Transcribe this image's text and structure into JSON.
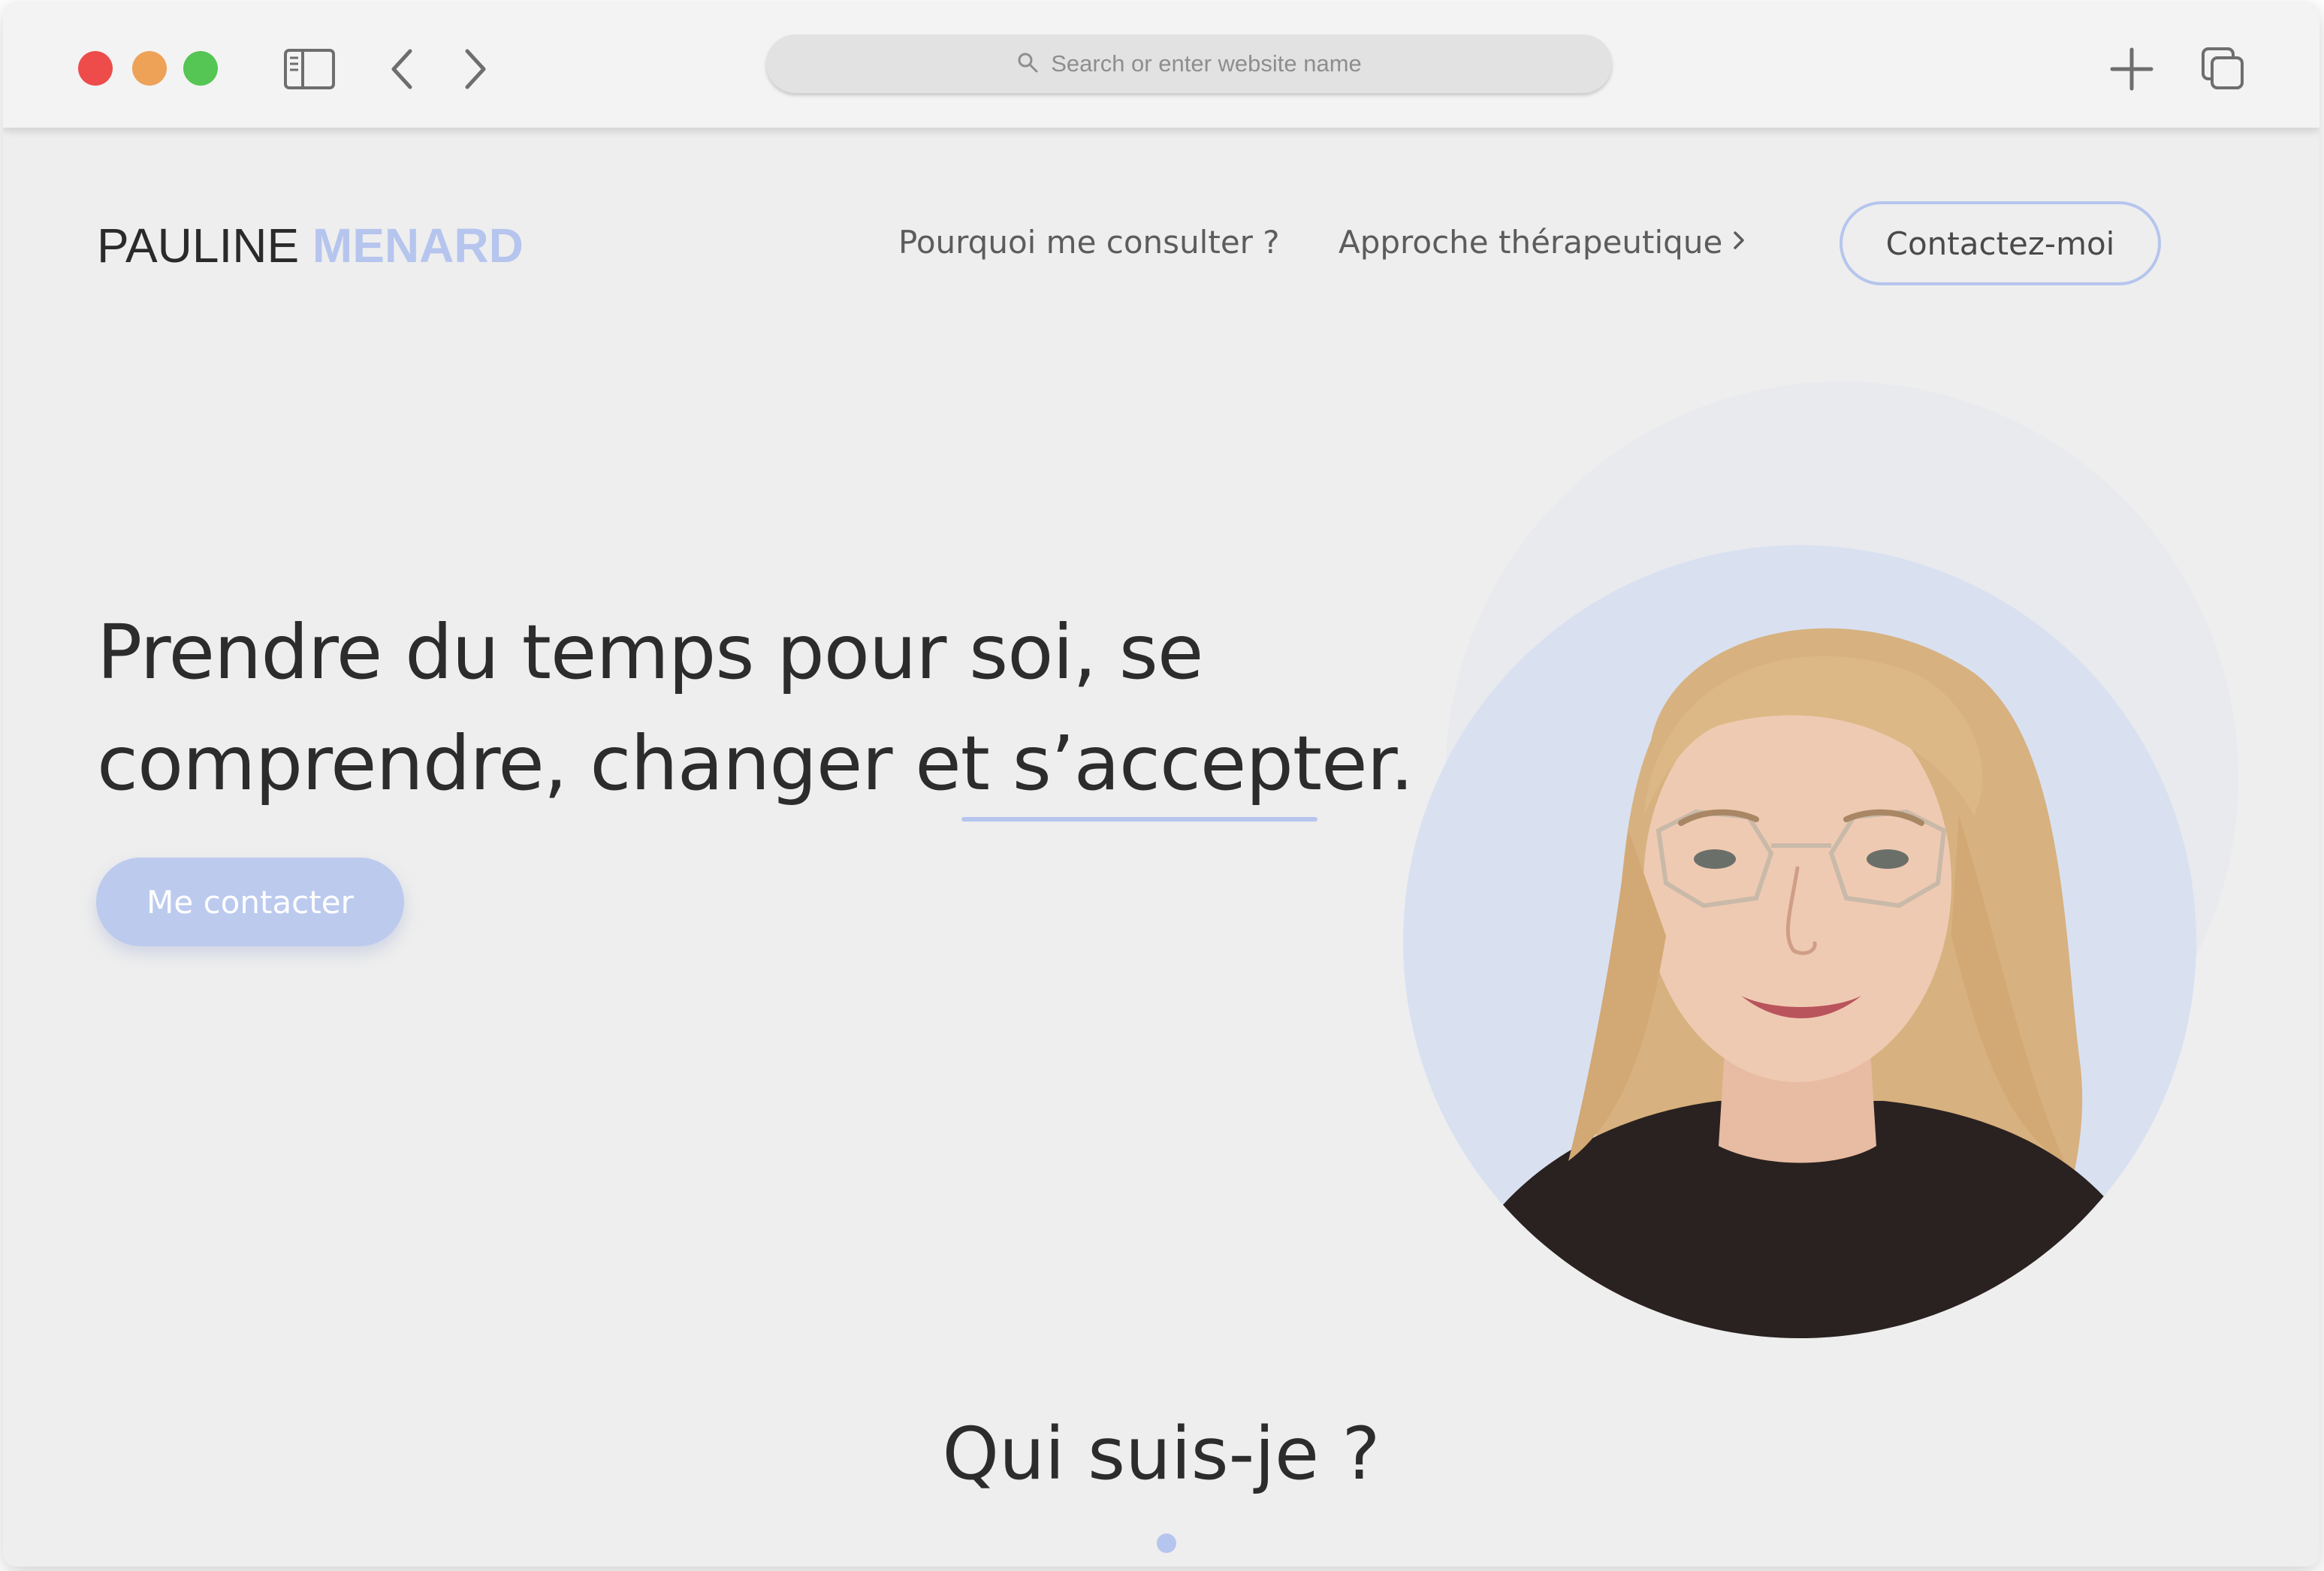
{
  "browser": {
    "address_placeholder": "Search or enter website name",
    "icons": [
      "close-light",
      "minimize-light",
      "zoom-light",
      "sidebar-icon",
      "back-icon",
      "forward-icon",
      "search-icon",
      "new-tab-icon",
      "tabs-overview-icon"
    ]
  },
  "site": {
    "logo_first": "PAULINE",
    "logo_last": "MENARD",
    "nav": {
      "link1": "Pourquoi me consulter ?",
      "link2": "Approche thérapeutique",
      "contact": "Contactez-moi"
    },
    "hero": {
      "line1": "Prendre du temps pour soi, se",
      "line2": "comprendre, changer et s’accepter.",
      "cta": "Me contacter"
    },
    "section_title": "Qui suis-je ?"
  },
  "colors": {
    "accent": "#b6c5ee",
    "text": "#2c2c2c",
    "background": "#eeeeee"
  }
}
